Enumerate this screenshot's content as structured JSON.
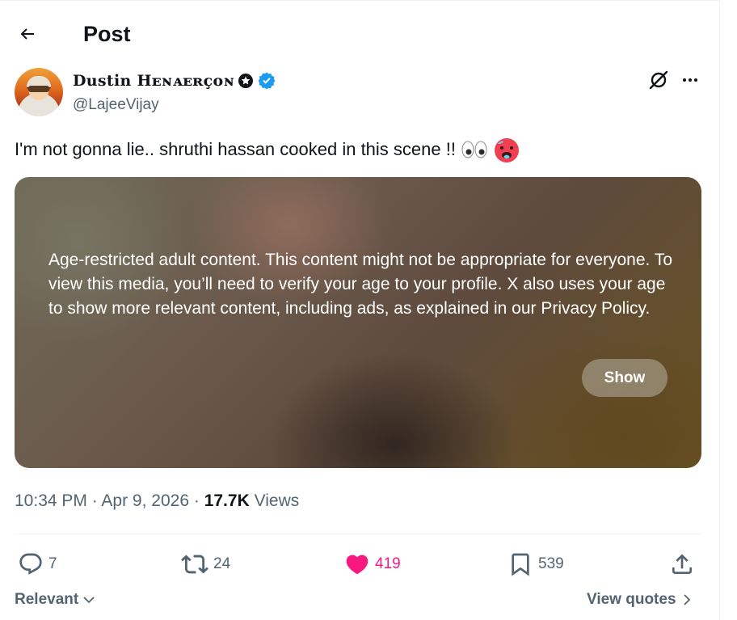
{
  "header": {
    "title": "Post"
  },
  "author": {
    "name": "𝕯𝖚𝖘𝖙𝖎𝖓 Hᴇɴᴀᴇʀçᴏɴ",
    "name_display": "Dustin Hᴇɴᴀᴇʀçᴏɴ",
    "handle": "@LajeeVijay",
    "verified": true,
    "verified_color": "#1d9bf0"
  },
  "post": {
    "text": "I'm not gonna lie.. shruthi hassan cooked in this scene !!",
    "emojis": [
      "eyes-emoji",
      "hot-face-emoji"
    ]
  },
  "media": {
    "warning_text": "Age-restricted adult content. This content might not be appropriate for everyone. To view this media, you’ll need to verify your age to your profile. X also uses your age to show more relevant content, including ads, as explained in our Privacy Policy.",
    "show_label": "Show"
  },
  "meta": {
    "time": "10:34 PM",
    "separator": "·",
    "date": "Apr 9, 2026",
    "views_count": "17.7K",
    "views_label": "Views"
  },
  "actions": {
    "replies": "7",
    "reposts": "24",
    "likes": "419",
    "bookmarks": "539",
    "like_color": "#f91880",
    "muted_color": "#536471"
  },
  "footer": {
    "sort_label": "Relevant",
    "view_quotes_label": "View quotes"
  }
}
